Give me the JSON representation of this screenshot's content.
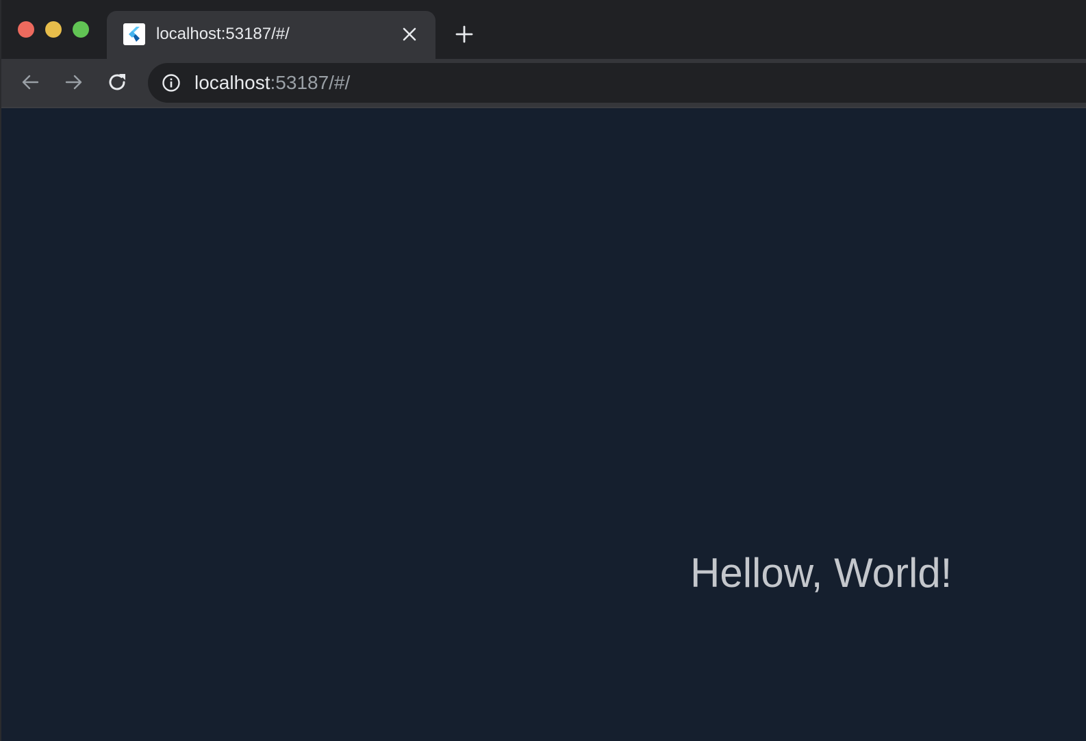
{
  "window": {
    "controls": {
      "close_color": "#ed6a5e",
      "minimize_color": "#e7bd4b",
      "maximize_color": "#61c454"
    }
  },
  "tabs": [
    {
      "title": "localhost:53187/#/",
      "favicon": "flutter-icon",
      "close_icon": "close-icon",
      "active": true
    }
  ],
  "new_tab_icon": "plus-icon",
  "toolbar": {
    "back_icon": "arrow-left-icon",
    "forward_icon": "arrow-right-icon",
    "reload_icon": "reload-icon",
    "site_info_icon": "info-icon"
  },
  "omnibox": {
    "url_host": "localhost",
    "url_rest": ":53187/#/"
  },
  "page": {
    "background_color": "#151f2e",
    "text": "Hellow, World!",
    "text_color": "#c4c7cc"
  }
}
